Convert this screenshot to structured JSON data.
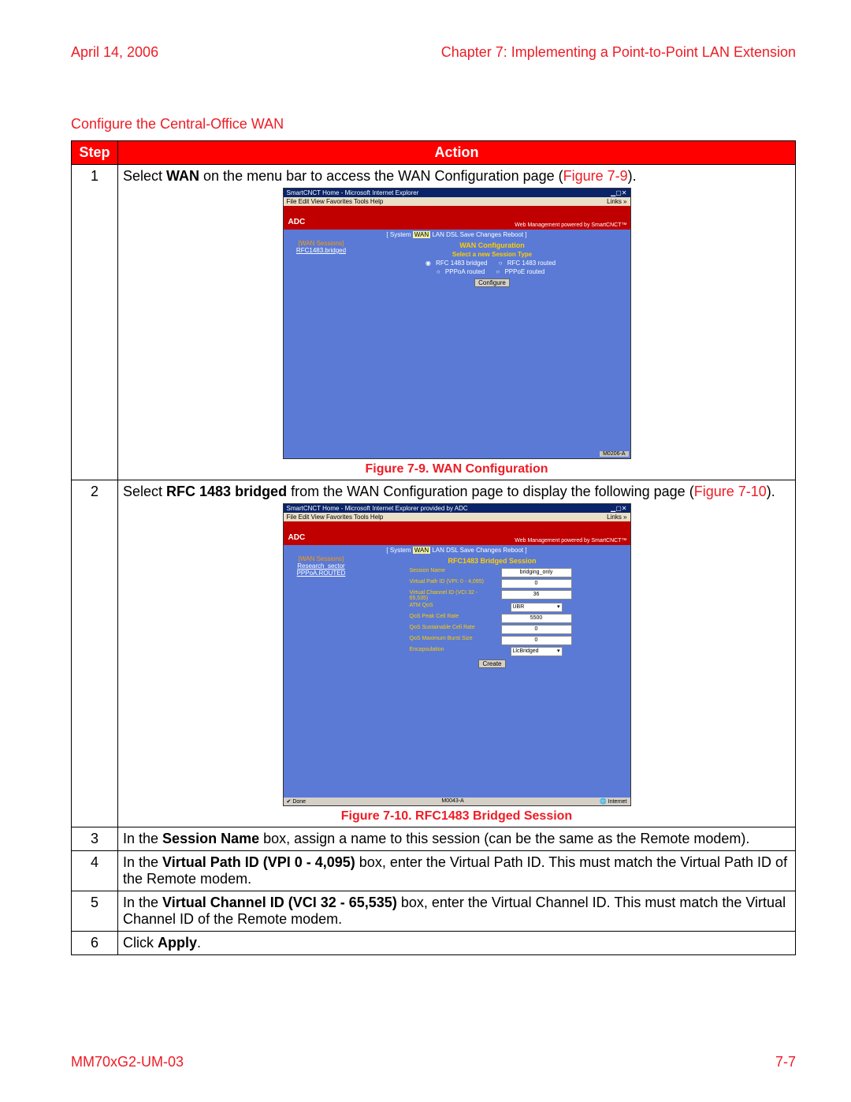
{
  "header": {
    "date": "April 14, 2006",
    "chapter": "Chapter 7: Implementing a Point-to-Point LAN Extension"
  },
  "section_title": "Configure the Central-Office WAN",
  "table": {
    "head_step": "Step",
    "head_action": "Action",
    "rows": [
      {
        "num": "1",
        "pre": "Select ",
        "bold1": "WAN",
        "mid": " on the menu bar to access the WAN Configuration page (",
        "figref": "Figure 7-9",
        "post": ")."
      },
      {
        "num": "2",
        "pre": "Select ",
        "bold1": "RFC 1483 bridged",
        "mid": " from the WAN Configuration page to display the following page (",
        "figref": "Figure 7-10",
        "post": ")."
      },
      {
        "num": "3",
        "pre": "In the ",
        "bold1": "Session Name",
        "post": " box, assign a name to this session (can be the same as the Remote modem)."
      },
      {
        "num": "4",
        "pre": "In the ",
        "bold1": "Virtual Path ID (VPI 0 - 4,095)",
        "post": " box, enter the Virtual Path ID. This must match the Virtual Path ID of the Remote modem."
      },
      {
        "num": "5",
        "pre": "In the ",
        "bold1": "Virtual Channel ID (VCI 32 - 65,535)",
        "post": " box, enter the Virtual Channel ID. This must match the Virtual Channel ID of the Remote modem."
      },
      {
        "num": "6",
        "pre": "Click ",
        "bold1": "Apply",
        "post": "."
      }
    ],
    "caption1": "Figure 7-9. WAN Configuration",
    "caption2": "Figure 7-10. RFC1483 Bridged Session"
  },
  "screenshot1": {
    "titlebar": "SmartCNCT Home - Microsoft Internet Explorer",
    "menubar": "File   Edit   View   Favorites   Tools   Help",
    "links": "Links »",
    "logo": "ADC",
    "powered": "Web Management powered by SmartCNCT™",
    "tabs_left": "[ System ",
    "tab_sel": "WAN",
    "tabs_right": " LAN  DSL  Save Changes  Reboot ]",
    "heading": "WAN Configuration",
    "left_label": "[WAN Sessions]",
    "left_link": "RFC1483.bridged",
    "sub": "Select a new Session Type",
    "r1a": "RFC 1483 bridged",
    "r1b": "RFC 1483 routed",
    "r2a": "PPPoA routed",
    "r2b": "PPPoE routed",
    "btn": "Configure",
    "corner": "M0206-A"
  },
  "screenshot2": {
    "titlebar": "SmartCNCT Home - Microsoft Internet Explorer provided by ADC",
    "menubar": "File   Edit   View   Favorites   Tools   Help",
    "links": "Links »",
    "logo": "ADC",
    "powered": "Web Management powered by SmartCNCT™",
    "tabs_left": "[ System ",
    "tab_sel": "WAN",
    "tabs_right": " LAN  DSL  Save Changes  Reboot ]",
    "heading": "RFC1483 Bridged Session",
    "left_label": "[WAN Sessions]",
    "left_link1": "Research_sector",
    "left_link2": "PPPoA.ROUTED",
    "fields": {
      "session_name_l": "Session Name",
      "session_name_v": "bridging_only",
      "vpi_l": "Virtual Path ID (VPI: 0 - 4,095)",
      "vpi_v": "0",
      "vci_l": "Virtual Channel ID (VCI 32 - 65,535)",
      "vci_v": "36",
      "atmqos_l": "ATM QoS",
      "atmqos_v": "UBR",
      "peak_l": "QoS Peak Cell Rate",
      "peak_v": "5500",
      "sust_l": "QoS Sustainable Cell Rate",
      "sust_v": "0",
      "burst_l": "QoS Maximum Burst Size",
      "burst_v": "0",
      "encap_l": "Encapsulation",
      "encap_v": "LlcBridged"
    },
    "btn": "Create",
    "status_left": "Done",
    "status_mid": "M0043-A",
    "status_right": "Internet"
  },
  "footer": {
    "doc": "MM70xG2-UM-03",
    "page": "7-7"
  }
}
